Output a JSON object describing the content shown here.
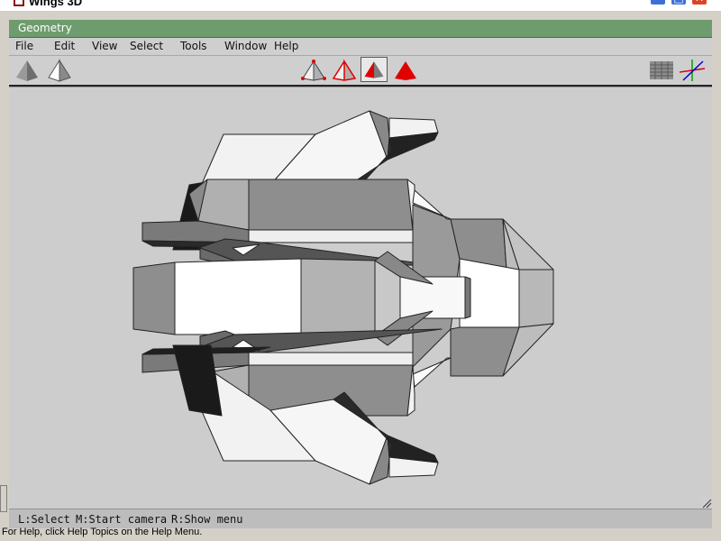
{
  "window": {
    "title": "Wings 3D",
    "buttons": {
      "minimize": "–",
      "maximize": "□",
      "close": "✕"
    }
  },
  "geometry_bar": {
    "label": "Geometry"
  },
  "menu": {
    "items": [
      "File",
      "Edit",
      "View",
      "Select",
      "Tools",
      "Window",
      "Help"
    ]
  },
  "toolbar": {
    "left_tools": [
      "pyramid-solid-icon",
      "pyramid-wire-icon"
    ],
    "select_modes": [
      "vertex-mode-icon",
      "edge-mode-icon",
      "face-mode-icon",
      "body-mode-icon"
    ],
    "active_mode": "face-mode-icon",
    "right_tools": [
      "ground-plane-icon",
      "axes-icon"
    ],
    "colors": {
      "accent": "#e00000",
      "selected": "#ffffff"
    }
  },
  "status": {
    "left": "L:Select",
    "middle": "M:Start camera",
    "right": "R:Show menu"
  },
  "help_text": "For Help, click Help Topics on the Help Menu."
}
